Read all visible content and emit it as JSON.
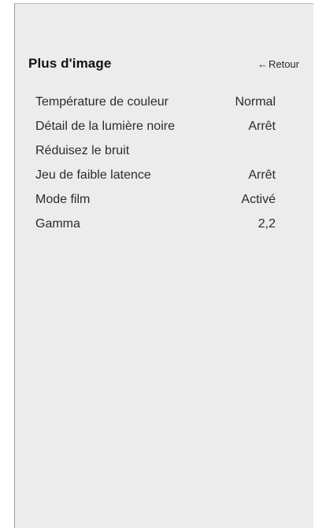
{
  "header": {
    "title": "Plus d'image",
    "back_label": "Retour",
    "back_arrow": "←"
  },
  "menu": {
    "items": [
      {
        "label": "Température de couleur",
        "value": "Normal"
      },
      {
        "label": "Détail de la lumière noire",
        "value": "Arrêt"
      },
      {
        "label": "Réduisez le bruit",
        "value": ""
      },
      {
        "label": "Jeu de faible latence",
        "value": "Arrêt"
      },
      {
        "label": "Mode film",
        "value": "Activé"
      },
      {
        "label": "Gamma",
        "value": "2,2"
      }
    ]
  },
  "colors": {
    "panel_bg": "#ececec",
    "text": "#2b2b2b",
    "title": "#111111"
  }
}
